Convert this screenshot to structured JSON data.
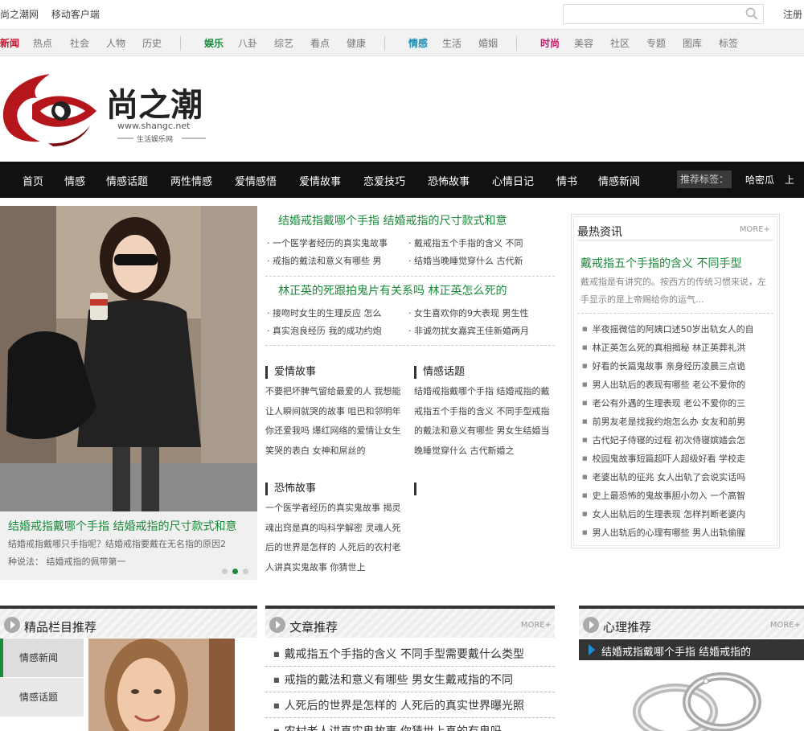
{
  "topbar": {
    "links": [
      "尚之潮网",
      "移动客户端"
    ],
    "search_placeholder": "",
    "register": "注册"
  },
  "channels": {
    "group1": [
      "新闻",
      "热点",
      "社会",
      "人物",
      "历史"
    ],
    "group2": [
      "娱乐",
      "八卦",
      "综艺",
      "看点",
      "健康"
    ],
    "group3": [
      "情感",
      "生活",
      "婚姻"
    ],
    "group4": [
      "时尚",
      "美容",
      "社区",
      "专题",
      "图库",
      "标签"
    ],
    "head_colors": {
      "新闻": "#c8102e",
      "娱乐": "#1b8a3a",
      "情感": "#1a8fb8",
      "时尚": "#d0186b"
    }
  },
  "logo": {
    "name": "尚之潮",
    "url_text": "www.shangc.net",
    "slogan": "生活娱乐网"
  },
  "main_nav": {
    "items": [
      "首页",
      "情感",
      "情感话题",
      "两性情感",
      "爱情感悟",
      "爱情故事",
      "恋爱技巧",
      "恐怖故事",
      "心情日记",
      "情书",
      "情感新闻"
    ],
    "tag_label": "推荐标签：",
    "tags": [
      "哈密瓜",
      "上"
    ]
  },
  "hero": {
    "title": "结婚戒指戴哪个手指 结婚戒指的尺寸款式和意",
    "desc1": "结婚戒指戴哪只手指呢？结婚戒指要戴在无名指的原因2",
    "desc2": "种说法： 结婚戒指的佩带第一"
  },
  "headlines": [
    {
      "title": "结婚戒指戴哪个手指 结婚戒指的尺寸款式和意",
      "links": [
        "一个医学者经历的真实鬼故事",
        "戴戒指五个手指的含义 不同",
        "戒指的戴法和意义有哪些 男",
        "结婚当晚睡觉穿什么 古代新"
      ]
    },
    {
      "title": "林正英的死跟拍鬼片有关系吗 林正英怎么死的",
      "links": [
        "接吻时女生的生理反应 怎么",
        "女生喜欢你的9大表现 男生性",
        "真实泡良经历 我的成功约炮",
        "非诚勿扰女嘉宾王佳新婚两月"
      ]
    }
  ],
  "sections": {
    "love_story": {
      "title": "爱情故事",
      "text": "不要把坏脾气留给最爱的人 我想能让人瞬间就哭的故事 咀巴和邻明年你还爱我吗 爆红网络的爱情让女生笑哭的表白 女神和屌丝的"
    },
    "emotion_topic": {
      "title": "情感话题",
      "text": "结婚戒指戴哪个手指 结婚戒指的戴戒指五个手指的含义 不同手型戒指的戴法和意义有哪些 男女生结婚当晚睡觉穿什么 古代新婚之"
    },
    "horror_story": {
      "title": "恐怖故事",
      "text": "一个医学者经历的真实鬼故事 揭灵魂出窍是真的吗科学解密 灵魂人死后的世界是怎样的 人死后的农村老人讲真实鬼故事 你猜世上"
    }
  },
  "hot_news": {
    "title": "最热资讯",
    "more": "MORE+",
    "feature_title": "戴戒指五个手指的含义 不同手型",
    "feature_desc": "戴戒指是有讲究的。按西方的传统习惯来说，左手显示的是上帝赐给你的运气...",
    "items": [
      "半夜摇微信的阿姨口述50岁出轨女人的自",
      "林正英怎么死的真相揭秘 林正英葬礼洪",
      "好看的长篇鬼故事 亲身经历凌晨三点诡",
      "男人出轨后的表现有哪些 老公不爱你的",
      "老公有外遇的生理表现 老公不爱你的三",
      "前男友老是找我约炮怎么办 女友和前男",
      "古代妃子侍寝的过程 初次侍寝嫔嫱会怎",
      "校园鬼故事短篇超吓人超级好看 学校走",
      "老婆出轨的征兆 女人出轨了会说实话吗",
      "史上最恐怖的鬼故事胆小勿入 一个高智",
      "女人出轨后的生理表现 怎样判断老婆内",
      "男人出轨后的心理有哪些 男人出轨偷腥"
    ]
  },
  "panels": {
    "column": {
      "title": "精品栏目推荐",
      "tabs": [
        "情感新闻",
        "情感话题"
      ]
    },
    "articles": {
      "title": "文章推荐",
      "more": "MORE+",
      "items": [
        "戴戒指五个手指的含义 不同手型需要戴什么类型",
        "戒指的戴法和意义有哪些 男女生戴戒指的不同",
        "人死后的世界是怎样的 人死后的真实世界曝光照",
        "农村老人讲真实鬼故事 你猜世上真的有鬼吗"
      ]
    },
    "psych": {
      "title": "心理推荐",
      "more": "MORE+",
      "bar_text": "结婚戒指戴哪个手指 结婚戒指的"
    }
  }
}
